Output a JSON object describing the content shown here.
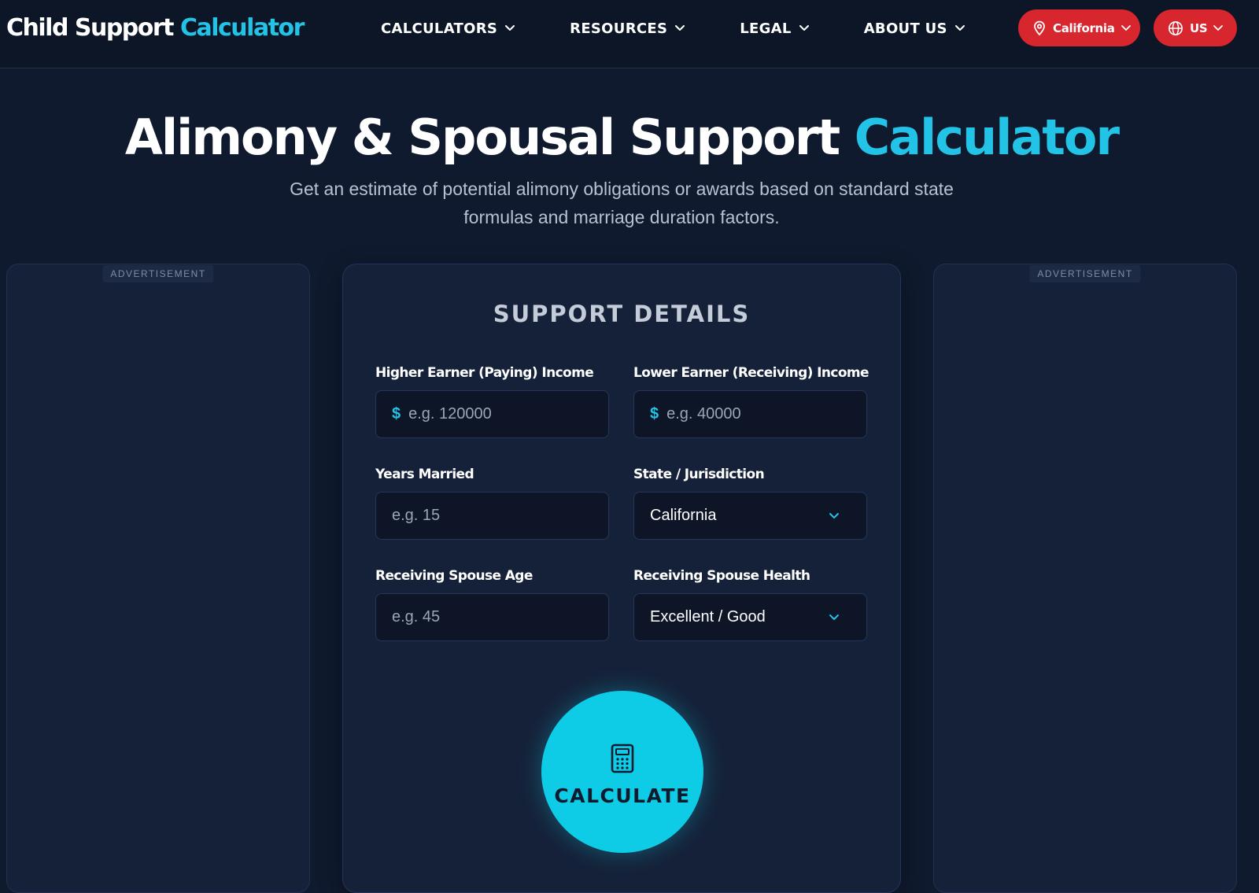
{
  "header": {
    "logo": {
      "part1": "Child Support",
      "part2": "Calculator"
    },
    "nav": [
      {
        "label": "CALCULATORS"
      },
      {
        "label": "RESOURCES"
      },
      {
        "label": "LEGAL"
      },
      {
        "label": "ABOUT US"
      }
    ],
    "location_button": "California",
    "country_button": "US"
  },
  "hero": {
    "title_part1": "Alimony & Spousal Support",
    "title_part2": "Calculator",
    "subtitle": "Get an estimate of potential alimony obligations or awards based on standard state formulas and marriage duration factors."
  },
  "ads": {
    "left_label": "ADVERTISEMENT",
    "right_label": "ADVERTISEMENT"
  },
  "form": {
    "title": "SUPPORT DETAILS",
    "fields": {
      "higher_income": {
        "label": "Higher Earner (Paying) Income",
        "currency": "$",
        "placeholder": "e.g. 120000",
        "value": ""
      },
      "lower_income": {
        "label": "Lower Earner (Receiving) Income",
        "currency": "$",
        "placeholder": "e.g. 40000",
        "value": ""
      },
      "years_married": {
        "label": "Years Married",
        "placeholder": "e.g. 15",
        "value": ""
      },
      "state": {
        "label": "State / Jurisdiction",
        "selected": "California"
      },
      "spouse_age": {
        "label": "Receiving Spouse Age",
        "placeholder": "e.g. 45",
        "value": ""
      },
      "spouse_health": {
        "label": "Receiving Spouse Health",
        "selected": "Excellent / Good"
      }
    },
    "calculate_label": "CALCULATE"
  },
  "colors": {
    "background": "#0f1a2e",
    "accent": "#22c3e6",
    "button_red": "#d7262e",
    "card": "#152138"
  },
  "icons": {
    "nav_chevron": "chevron-down-icon",
    "location": "map-pin-icon",
    "globe": "globe-icon",
    "calculator": "calculator-icon"
  }
}
